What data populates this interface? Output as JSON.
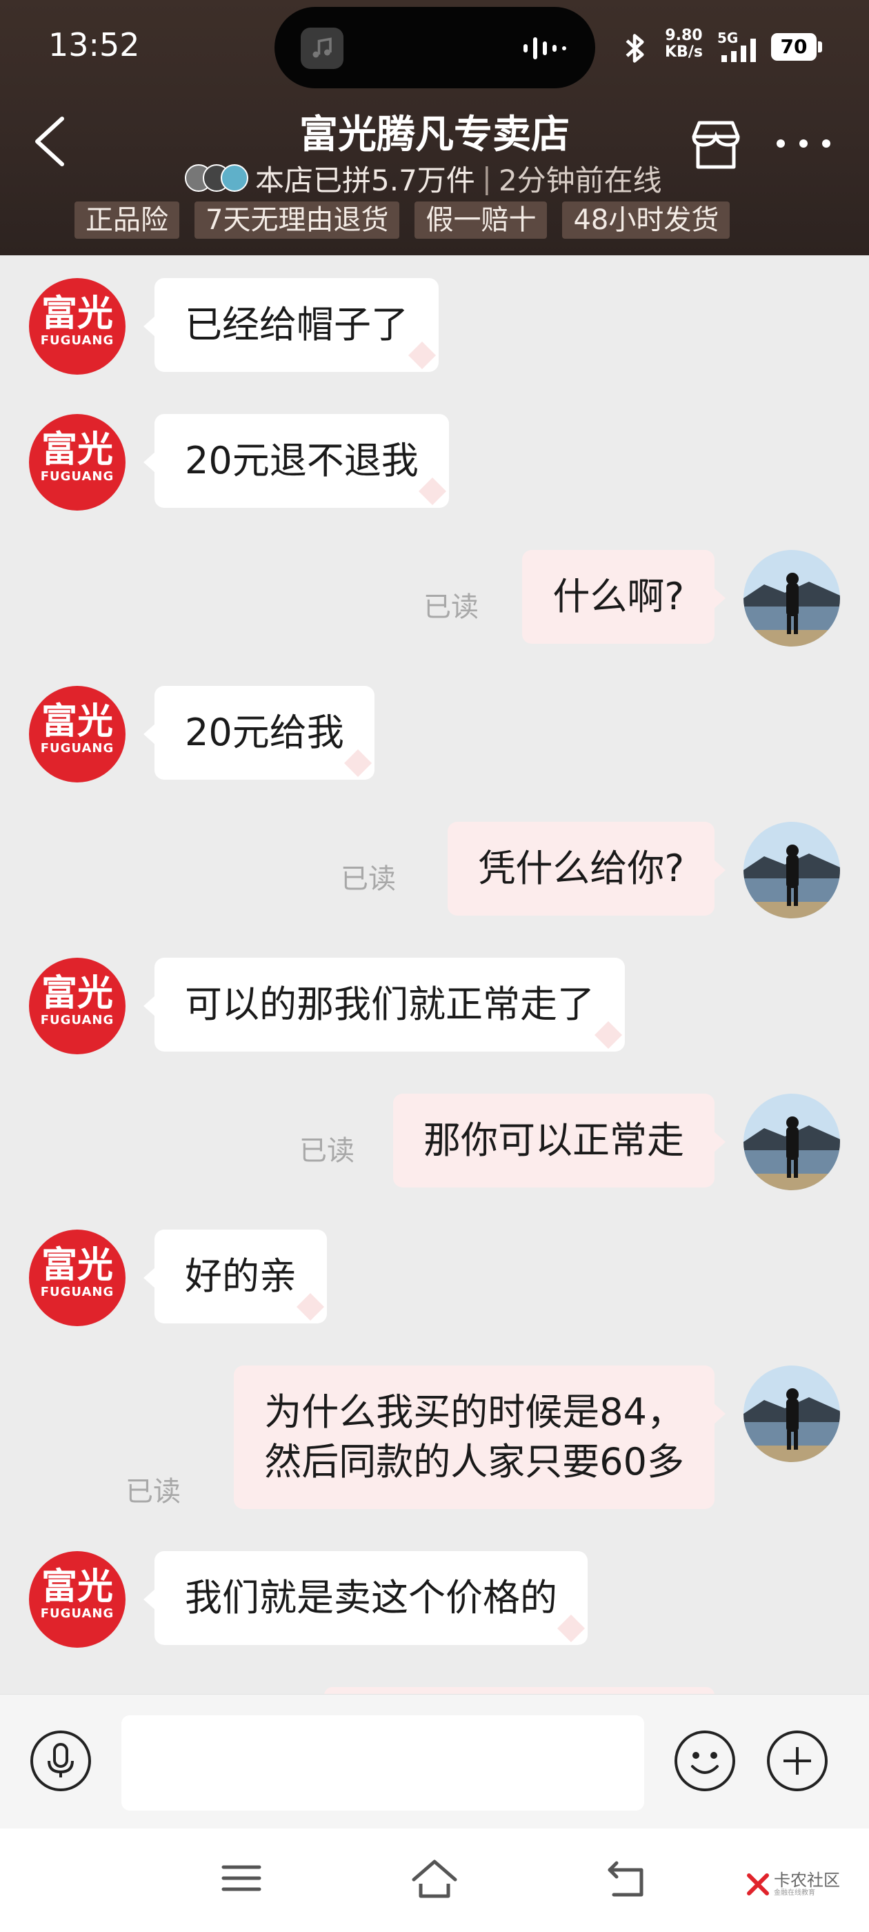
{
  "status_bar": {
    "time": "13:52",
    "net_speed_value": "9.80",
    "net_speed_unit": "KB/s",
    "network": "5G",
    "battery": "70"
  },
  "header": {
    "title": "富光腾凡专卖店",
    "sold": "本店已拼5.7万件",
    "online": "2分钟前在线",
    "badges": [
      "正品险",
      "7天无理由退货",
      "假一赔十",
      "48小时发货"
    ]
  },
  "shop_avatar": {
    "line1": "富光",
    "line2": "FUGUANG",
    "color": "#e0232b"
  },
  "read_label": "已读",
  "messages": [
    {
      "side": "left",
      "text": "已经给帽子了"
    },
    {
      "side": "left",
      "text": "20元退不退我"
    },
    {
      "side": "right",
      "text": "什么啊?",
      "read": true
    },
    {
      "side": "left",
      "text": "20元给我"
    },
    {
      "side": "right",
      "text": "凭什么给你?",
      "read": true
    },
    {
      "side": "left",
      "text": "可以的那我们就正常走了"
    },
    {
      "side": "right",
      "text": "那你可以正常走",
      "read": true
    },
    {
      "side": "left",
      "text": "好的亲"
    },
    {
      "side": "right",
      "line1": "为什么我买的时候是84，",
      "line2": "然后同款的人家只要60多",
      "read": true
    },
    {
      "side": "left",
      "text": "我们就是卖这个价格的"
    }
  ],
  "input": {
    "placeholder": ""
  },
  "watermark": {
    "name": "卡农社区",
    "tagline": "金融在线教育"
  },
  "colors": {
    "header_bg": "#352925",
    "chat_bg": "#ececec",
    "right_bubble": "#fcecec",
    "brand_red": "#e0232b"
  }
}
